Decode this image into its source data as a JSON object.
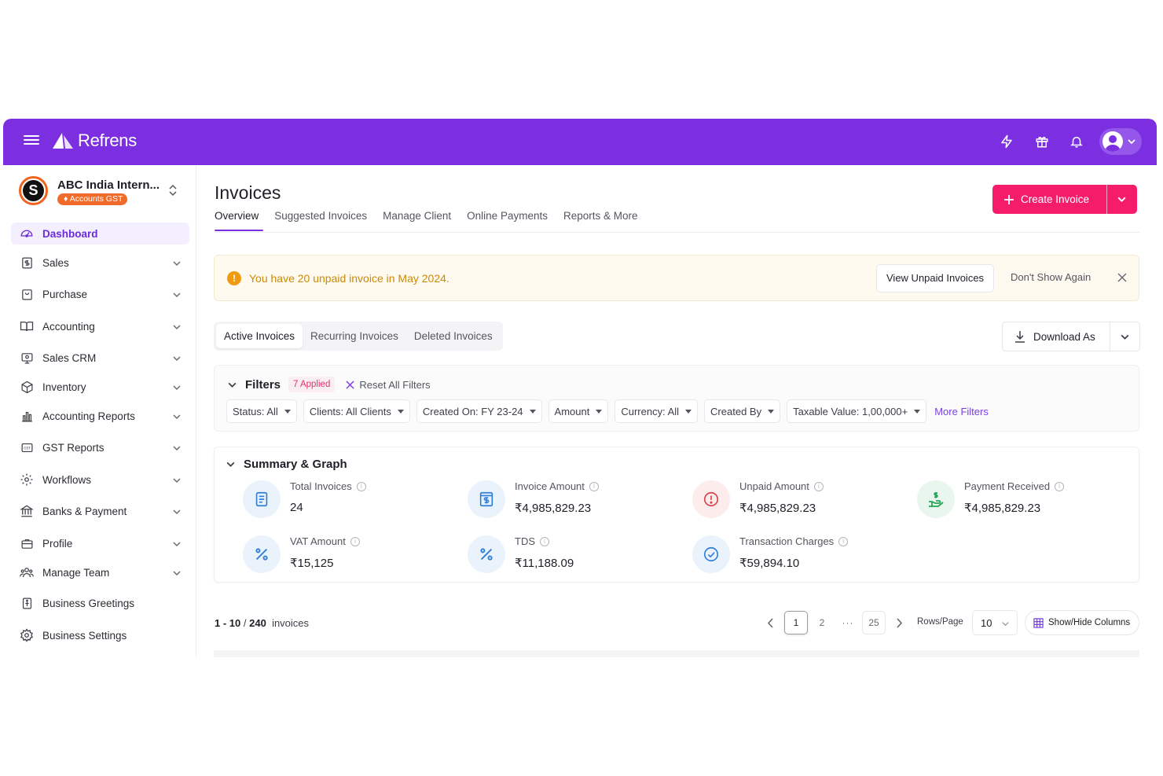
{
  "brand": {
    "name": "Refrens"
  },
  "topbar": {
    "icons": [
      "lightning-icon",
      "gift-icon",
      "bell-icon",
      "user-avatar"
    ]
  },
  "org": {
    "name": "ABC India Intern...",
    "badge": "Accounts GST",
    "logo_glyph": "S"
  },
  "sidebar": {
    "items": [
      {
        "label": "Dashboard",
        "icon": "dashboard-icon",
        "active": true,
        "chevron": false
      },
      {
        "label": "Sales",
        "icon": "dollar-doc-icon",
        "chevron": true
      },
      {
        "label": "Purchase",
        "icon": "bag-icon",
        "chevron": true
      },
      {
        "label": "Accounting",
        "icon": "book-icon",
        "chevron": true
      },
      {
        "label": "Sales CRM",
        "icon": "crm-icon",
        "chevron": true
      },
      {
        "label": "Inventory",
        "icon": "box-icon",
        "chevron": true
      },
      {
        "label": "Accounting Reports",
        "icon": "bar-chart-icon",
        "chevron": true
      },
      {
        "label": "GST Reports",
        "icon": "gst-icon",
        "chevron": true
      },
      {
        "label": "Workflows",
        "icon": "workflow-gear-icon",
        "chevron": true
      },
      {
        "label": "Banks & Payment",
        "icon": "bank-icon",
        "chevron": true
      },
      {
        "label": "Profile",
        "icon": "briefcase-icon",
        "chevron": true
      },
      {
        "label": "Manage Team",
        "icon": "team-icon",
        "chevron": true
      },
      {
        "label": "Business Greetings",
        "icon": "greeting-icon",
        "chevron": false
      },
      {
        "label": "Business Settings",
        "icon": "settings-icon",
        "chevron": false
      }
    ]
  },
  "header": {
    "title": "Invoices",
    "tabs": [
      "Overview",
      "Suggested Invoices",
      "Manage Client",
      "Online Payments",
      "Reports & More"
    ],
    "create_label": "Create Invoice"
  },
  "alert": {
    "message": "You have 20 unpaid invoice in May 2024.",
    "view_label": "View Unpaid Invoices",
    "dismiss_label": "Don't Show Again"
  },
  "invoice_tabs": [
    "Active Invoices",
    "Recurring Invoices",
    "Deleted Invoices"
  ],
  "download": {
    "label": "Download As"
  },
  "filters": {
    "title": "Filters",
    "applied": "7 Applied",
    "reset_label": "Reset All Filters",
    "chips": [
      "Status: All",
      "Clients: All Clients",
      "Created On: FY 23-24",
      "Amount",
      "Currency: All",
      "Created By",
      "Taxable Value: 1,00,000+"
    ],
    "more_label": "More Filters"
  },
  "summary": {
    "title": "Summary & Graph",
    "stats": [
      {
        "label": "Total Invoices",
        "value": "24",
        "icon": "document-list-icon",
        "color": "#2f7fd6",
        "bg": "#eaf3fc"
      },
      {
        "label": "Invoice Amount",
        "value": "₹4,985,829.23",
        "icon": "dollar-bill-icon",
        "color": "#2f7fd6",
        "bg": "#eaf3fc"
      },
      {
        "label": "Unpaid Amount",
        "value": "₹4,985,829.23",
        "icon": "alert-circle-icon",
        "color": "#d8424a",
        "bg": "#fdecec"
      },
      {
        "label": "Payment Received",
        "value": "₹4,985,829.23",
        "icon": "hand-money-icon",
        "color": "#27a55a",
        "bg": "#e8f6ee"
      },
      {
        "label": "VAT Amount",
        "value": "₹15,125",
        "icon": "percent-icon",
        "color": "#2f7fd6",
        "bg": "#eaf3fc"
      },
      {
        "label": "TDS",
        "value": "₹11,188.09",
        "icon": "percent-icon",
        "color": "#2f7fd6",
        "bg": "#eaf3fc"
      },
      {
        "label": "Transaction Charges",
        "value": "₹59,894.10",
        "icon": "check-circle-icon",
        "color": "#2f7fd6",
        "bg": "#eaf3fc"
      }
    ]
  },
  "pagination": {
    "range": "1 - 10",
    "separator": "/",
    "total": "240",
    "unit": "invoices",
    "pages": [
      "1",
      "2",
      "···",
      "25"
    ],
    "current": "1",
    "rows_label": "Rows/Page",
    "rows_value": "10",
    "columns_label": "Show/Hide Columns"
  }
}
